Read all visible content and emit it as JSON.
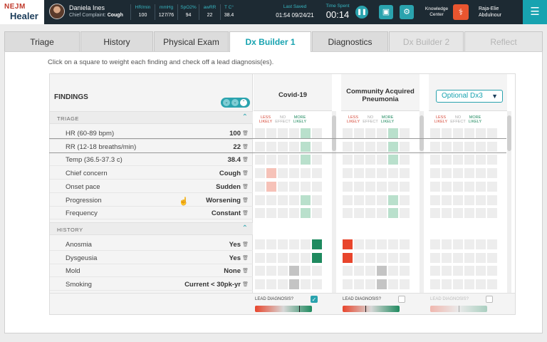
{
  "app": {
    "logo_top": "NEJM",
    "logo_bottom": "Healer"
  },
  "patient": {
    "name": "Daniela Ines",
    "cc_label": "Chief Complaint:",
    "cc_value": "Cough"
  },
  "vitals": [
    {
      "label": "HR/min",
      "value": "100"
    },
    {
      "label": "mmHg",
      "value": "127/76"
    },
    {
      "label": "SpO2%",
      "value": "94"
    },
    {
      "label": "awRR",
      "value": "22"
    },
    {
      "label": "T C°",
      "value": "38.4"
    }
  ],
  "status": {
    "saved_label": "Last Saved",
    "saved_value": "01:54 09/24/21",
    "time_label": "Time Spent",
    "time_value": "00:14"
  },
  "toolbar": {
    "pause_icon": "pause-icon",
    "save_icon": "save-icon",
    "settings_icon": "gear-icon",
    "kc_label_1": "Knowledge",
    "kc_label_2": "Center",
    "kc_icon": "stethoscope-icon",
    "user_line_1": "Raja-Elie",
    "user_line_2": "Abdulnour",
    "menu_icon": "hamburger-icon"
  },
  "tabs": [
    {
      "label": "Triage",
      "state": "normal"
    },
    {
      "label": "History",
      "state": "normal"
    },
    {
      "label": "Physical Exam",
      "state": "normal"
    },
    {
      "label": "Dx Builder 1",
      "state": "active"
    },
    {
      "label": "Diagnostics",
      "state": "normal"
    },
    {
      "label": "Dx Builder 2",
      "state": "disabled"
    },
    {
      "label": "Reflect",
      "state": "disabled"
    }
  ],
  "instruction": "Click on a square to weight each finding and check off a lead diagnosis(es).",
  "findings": {
    "title": "FINDINGS",
    "sections": [
      {
        "label": "TRIAGE",
        "rows": [
          {
            "name": "HR (60-89 bpm)",
            "value": "100"
          },
          {
            "name": "RR (12-18 breaths/min)",
            "value": "22"
          },
          {
            "name": "Temp (36.5-37.3 c)",
            "value": "38.4"
          },
          {
            "name": "Chief concern",
            "value": "Cough"
          },
          {
            "name": "Onset pace",
            "value": "Sudden"
          },
          {
            "name": "Progression",
            "value": "Worsening"
          },
          {
            "name": "Frequency",
            "value": "Constant"
          }
        ]
      },
      {
        "label": "HISTORY",
        "rows": [
          {
            "name": "Anosmia",
            "value": "Yes"
          },
          {
            "name": "Dysgeusia",
            "value": "Yes"
          },
          {
            "name": "Mold",
            "value": "None"
          },
          {
            "name": "Smoking",
            "value": "Current < 30pk-yr"
          }
        ]
      }
    ]
  },
  "diagnoses": [
    {
      "title": "Covid-19",
      "is_select": false,
      "lead": true,
      "weights": [
        {
          "row": 0,
          "col": 4,
          "color": "#b9e0cc"
        },
        {
          "row": 1,
          "col": 4,
          "color": "#b9e0cc"
        },
        {
          "row": 2,
          "col": 4,
          "color": "#b9e0cc"
        },
        {
          "row": 3,
          "col": 1,
          "color": "#f6c2b8"
        },
        {
          "row": 4,
          "col": 1,
          "color": "#f6c2b8"
        },
        {
          "row": 5,
          "col": 4,
          "color": "#b9e0cc"
        },
        {
          "row": 6,
          "col": 4,
          "color": "#b9e0cc"
        },
        {
          "row": 7,
          "col": 5,
          "color": "#1f8a5f"
        },
        {
          "row": 8,
          "col": 5,
          "color": "#1f8a5f"
        },
        {
          "row": 9,
          "col": 3,
          "color": "#c4c4c4"
        },
        {
          "row": 10,
          "col": 3,
          "color": "#c4c4c4"
        }
      ],
      "likelihood": 0.78
    },
    {
      "title": "Community Acquired Pneumonia",
      "is_select": false,
      "lead": false,
      "weights": [
        {
          "row": 0,
          "col": 4,
          "color": "#b9e0cc"
        },
        {
          "row": 1,
          "col": 4,
          "color": "#b9e0cc"
        },
        {
          "row": 2,
          "col": 4,
          "color": "#b9e0cc"
        },
        {
          "row": 5,
          "col": 4,
          "color": "#b9e0cc"
        },
        {
          "row": 6,
          "col": 4,
          "color": "#b9e0cc"
        },
        {
          "row": 7,
          "col": 0,
          "color": "#e8452c"
        },
        {
          "row": 8,
          "col": 0,
          "color": "#e8452c"
        },
        {
          "row": 9,
          "col": 3,
          "color": "#c4c4c4"
        },
        {
          "row": 10,
          "col": 3,
          "color": "#c4c4c4"
        }
      ],
      "likelihood": 0.4
    },
    {
      "title": "Optional Dx3",
      "is_select": true,
      "lead": false,
      "weights": [],
      "likelihood": 0.5
    }
  ],
  "column_labels": {
    "less": [
      "LESS",
      "LIKELY"
    ],
    "none": [
      "NO",
      "EFFECT"
    ],
    "more": [
      "MORE",
      "LIKELY"
    ]
  },
  "lead_label": "LEAD DIAGNOSIS?",
  "colors": {
    "accent": "#2aa3ae",
    "topbar": "#1d2a33",
    "less_likely": "#e8452c",
    "more_likely": "#1f8a5f"
  }
}
